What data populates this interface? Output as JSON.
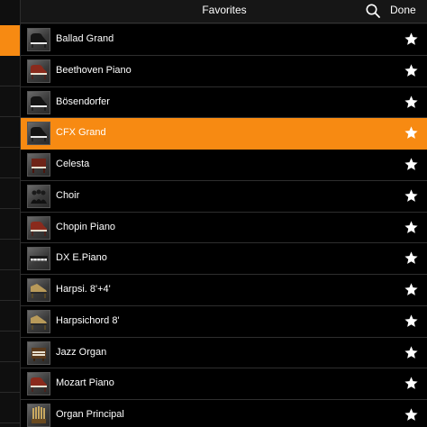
{
  "header": {
    "title": "Favorites",
    "done_label": "Done",
    "search_icon": "search-icon"
  },
  "colors": {
    "accent": "#f78a12",
    "background": "#000000",
    "text": "#ffffff"
  },
  "instruments": [
    {
      "name": "Ballad Grand",
      "icon": "grand-piano-icon",
      "favorite": true,
      "selected": false
    },
    {
      "name": "Beethoven Piano",
      "icon": "fortepiano-icon",
      "favorite": true,
      "selected": false
    },
    {
      "name": "Bösendorfer",
      "icon": "grand-piano-icon",
      "favorite": true,
      "selected": false
    },
    {
      "name": "CFX Grand",
      "icon": "grand-piano-icon",
      "favorite": true,
      "selected": true
    },
    {
      "name": "Celesta",
      "icon": "celesta-icon",
      "favorite": true,
      "selected": false
    },
    {
      "name": "Choir",
      "icon": "choir-icon",
      "favorite": true,
      "selected": false
    },
    {
      "name": "Chopin Piano",
      "icon": "fortepiano-icon",
      "favorite": true,
      "selected": false
    },
    {
      "name": "DX E.Piano",
      "icon": "electric-piano-icon",
      "favorite": true,
      "selected": false
    },
    {
      "name": "Harpsi. 8'+4'",
      "icon": "harpsichord-icon",
      "favorite": true,
      "selected": false
    },
    {
      "name": "Harpsichord 8'",
      "icon": "harpsichord-icon",
      "favorite": true,
      "selected": false
    },
    {
      "name": "Jazz Organ",
      "icon": "organ-icon",
      "favorite": true,
      "selected": false
    },
    {
      "name": "Mozart Piano",
      "icon": "fortepiano-icon",
      "favorite": true,
      "selected": false
    },
    {
      "name": "Organ Principal",
      "icon": "pipe-organ-icon",
      "favorite": true,
      "selected": false
    }
  ]
}
